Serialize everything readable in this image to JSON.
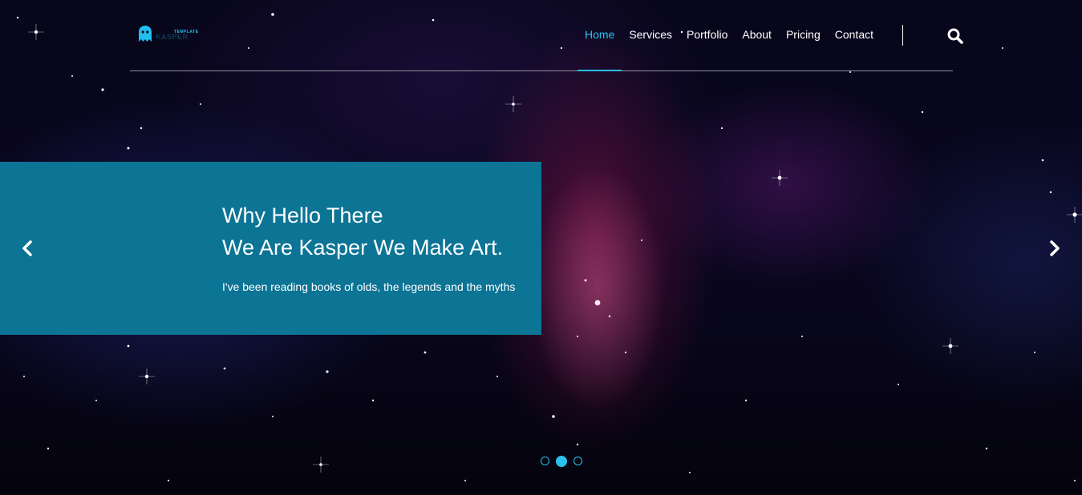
{
  "brand": {
    "tagline": "TEMPLATE",
    "name": "KASPER",
    "logo_icon": "ghost-icon",
    "accent_color": "#2ac0ef"
  },
  "nav": {
    "items": [
      {
        "label": "Home",
        "active": true
      },
      {
        "label": "Services",
        "active": false
      },
      {
        "label": "Portfolio",
        "active": false
      },
      {
        "label": "About",
        "active": false
      },
      {
        "label": "Pricing",
        "active": false
      },
      {
        "label": "Contact",
        "active": false
      }
    ],
    "search_icon": "search-icon"
  },
  "slider": {
    "title_line1": "Why Hello There",
    "title_line2": "We Are Kasper We Make Art.",
    "text": "I've been reading books of olds, the legends and the myths",
    "caption_bg": "#0c7495",
    "prev_icon": "chevron-left-icon",
    "next_icon": "chevron-right-icon",
    "slide_count": 3,
    "active_slide": 2
  }
}
